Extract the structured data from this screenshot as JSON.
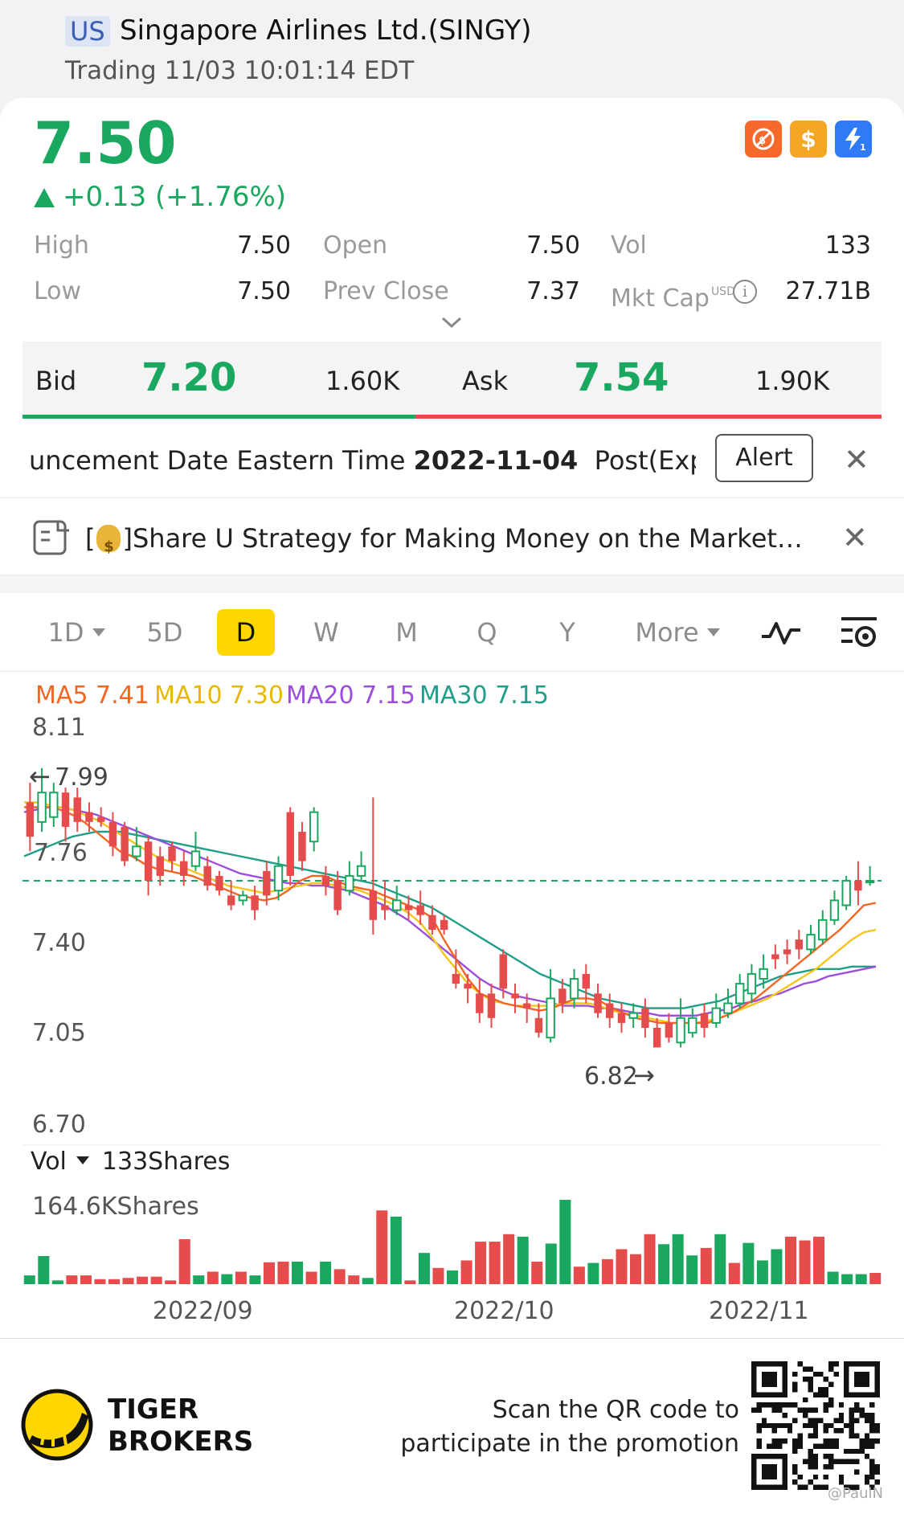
{
  "header": {
    "market": "US",
    "name": "Singapore Airlines Ltd.(SINGY)",
    "status": "Trading 11/03 10:01:14 EDT"
  },
  "quote": {
    "price": "7.50",
    "change": "+0.13 (+1.76%)",
    "badges": [
      {
        "icon": "no-shorting-icon",
        "color": "#f56a2b"
      },
      {
        "icon": "dollar-icon",
        "color": "#f5a623"
      },
      {
        "icon": "lightning-icon",
        "color": "#2f7bf5"
      }
    ]
  },
  "stats": {
    "high_label": "High",
    "high": "7.50",
    "low_label": "Low",
    "low": "7.50",
    "open_label": "Open",
    "open": "7.50",
    "prev_close_label": "Prev Close",
    "prev_close": "7.37",
    "vol_label": "Vol",
    "vol": "133",
    "mkt_cap_label": "Mkt Cap",
    "mkt_cap_currency": "USD",
    "mkt_cap": "27.71B"
  },
  "bidask": {
    "bid_label": "Bid",
    "bid": "7.20",
    "bid_size": "1.60K",
    "ask_label": "Ask",
    "ask": "7.54",
    "ask_size": "1.90K"
  },
  "announcement": {
    "text_pre": "uncement Date Eastern Time ",
    "date": "2022-11-04",
    "text_post": "  Post(Expe",
    "alert_label": "Alert"
  },
  "share": {
    "bracket_open": "[",
    "text": "]Share U Strategy for Making Money on the Market…"
  },
  "tabs": [
    {
      "label": "1D",
      "dropdown": true
    },
    {
      "label": "5D"
    },
    {
      "label": "D",
      "active": true
    },
    {
      "label": "W"
    },
    {
      "label": "M"
    },
    {
      "label": "Q"
    },
    {
      "label": "Y"
    },
    {
      "label": "More",
      "dropdown": true
    }
  ],
  "ma": {
    "ma5": "MA5 7.41",
    "ma10": "MA10 7.30",
    "ma20": "MA20 7.15",
    "ma30": "MA30 7.15",
    "colors": {
      "ma5": "#f26522",
      "ma10": "#f5c518",
      "ma20": "#9b4ddc",
      "ma30": "#1f9e8a"
    }
  },
  "chart_data": {
    "type": "candlestick",
    "y_ticks": [
      "8.11",
      "7.40",
      "7.05",
      "6.70"
    ],
    "ylim": [
      6.7,
      8.11
    ],
    "max_label": "7.99",
    "min_label": "6.82",
    "side_label": "7.76",
    "last_price_line": 7.5,
    "x_labels": [
      "2022/09",
      "2022/10",
      "2022/11"
    ],
    "candles": [
      [
        7.82,
        7.68,
        7.9,
        7.62
      ],
      [
        7.74,
        7.86,
        7.96,
        7.7
      ],
      [
        7.76,
        7.86,
        7.9,
        7.72
      ],
      [
        7.86,
        7.72,
        7.88,
        7.66
      ],
      [
        7.84,
        7.74,
        7.88,
        7.7
      ],
      [
        7.78,
        7.74,
        7.82,
        7.7
      ],
      [
        7.76,
        7.74,
        7.8,
        7.72
      ],
      [
        7.74,
        7.64,
        7.78,
        7.6
      ],
      [
        7.72,
        7.58,
        7.74,
        7.56
      ],
      [
        7.6,
        7.64,
        7.72,
        7.58
      ],
      [
        7.66,
        7.5,
        7.68,
        7.44
      ],
      [
        7.6,
        7.52,
        7.64,
        7.48
      ],
      [
        7.64,
        7.58,
        7.66,
        7.54
      ],
      [
        7.58,
        7.52,
        7.62,
        7.48
      ],
      [
        7.56,
        7.62,
        7.7,
        7.54
      ],
      [
        7.56,
        7.48,
        7.6,
        7.46
      ],
      [
        7.52,
        7.46,
        7.54,
        7.44
      ],
      [
        7.44,
        7.4,
        7.5,
        7.38
      ],
      [
        7.42,
        7.44,
        7.46,
        7.4
      ],
      [
        7.44,
        7.38,
        7.48,
        7.34
      ],
      [
        7.54,
        7.44,
        7.58,
        7.4
      ],
      [
        7.46,
        7.56,
        7.6,
        7.42
      ],
      [
        7.78,
        7.52,
        7.8,
        7.48
      ],
      [
        7.7,
        7.58,
        7.74,
        7.54
      ],
      [
        7.66,
        7.78,
        7.8,
        7.62
      ],
      [
        7.52,
        7.48,
        7.56,
        7.44
      ],
      [
        7.5,
        7.38,
        7.54,
        7.36
      ],
      [
        7.46,
        7.52,
        7.58,
        7.44
      ],
      [
        7.52,
        7.56,
        7.62,
        7.5
      ],
      [
        7.46,
        7.34,
        7.84,
        7.28
      ],
      [
        7.4,
        7.38,
        7.5,
        7.34
      ],
      [
        7.38,
        7.42,
        7.48,
        7.36
      ],
      [
        7.4,
        7.38,
        7.44,
        7.34
      ],
      [
        7.4,
        7.36,
        7.46,
        7.32
      ],
      [
        7.36,
        7.3,
        7.4,
        7.28
      ],
      [
        7.34,
        7.3,
        7.36,
        7.28
      ],
      [
        7.12,
        7.08,
        7.22,
        7.06
      ],
      [
        7.08,
        7.06,
        7.12,
        7.0
      ],
      [
        7.04,
        6.96,
        7.1,
        6.92
      ],
      [
        7.04,
        6.94,
        7.08,
        6.9
      ],
      [
        7.2,
        7.06,
        7.22,
        7.02
      ],
      [
        7.04,
        7.02,
        7.08,
        6.96
      ],
      [
        7.0,
        6.98,
        7.04,
        6.92
      ],
      [
        6.94,
        6.88,
        7.0,
        6.86
      ],
      [
        6.86,
        7.02,
        7.14,
        6.84
      ],
      [
        7.06,
        7.0,
        7.1,
        6.96
      ],
      [
        7.02,
        7.1,
        7.14,
        6.98
      ],
      [
        7.12,
        7.06,
        7.16,
        7.0
      ],
      [
        7.04,
        6.96,
        7.08,
        6.94
      ],
      [
        7.0,
        6.94,
        7.04,
        6.9
      ],
      [
        6.96,
        6.92,
        7.0,
        6.88
      ],
      [
        6.94,
        6.96,
        7.0,
        6.9
      ],
      [
        6.98,
        6.9,
        7.02,
        6.86
      ],
      [
        6.9,
        6.82,
        6.94,
        6.82
      ],
      [
        6.92,
        6.86,
        6.96,
        6.84
      ],
      [
        6.84,
        6.94,
        7.02,
        6.82
      ],
      [
        6.88,
        6.94,
        6.98,
        6.86
      ],
      [
        6.96,
        6.9,
        7.0,
        6.86
      ],
      [
        6.92,
        6.98,
        7.04,
        6.9
      ],
      [
        6.96,
        7.0,
        7.06,
        6.94
      ],
      [
        7.0,
        7.08,
        7.12,
        6.98
      ],
      [
        7.04,
        7.12,
        7.16,
        7.0
      ],
      [
        7.1,
        7.14,
        7.2,
        7.06
      ],
      [
        7.2,
        7.18,
        7.24,
        7.14
      ],
      [
        7.22,
        7.2,
        7.26,
        7.16
      ],
      [
        7.26,
        7.22,
        7.3,
        7.18
      ],
      [
        7.22,
        7.28,
        7.32,
        7.2
      ],
      [
        7.26,
        7.34,
        7.38,
        7.24
      ],
      [
        7.34,
        7.42,
        7.46,
        7.32
      ],
      [
        7.4,
        7.5,
        7.52,
        7.38
      ],
      [
        7.5,
        7.46,
        7.58,
        7.4
      ],
      [
        7.5,
        7.5,
        7.56,
        7.48
      ]
    ],
    "ma_series": {
      "ma5": [
        7.8,
        7.8,
        7.8,
        7.79,
        7.77,
        7.74,
        7.7,
        7.66,
        7.62,
        7.6,
        7.57,
        7.55,
        7.54,
        7.53,
        7.52,
        7.5,
        7.48,
        7.46,
        7.44,
        7.43,
        7.42,
        7.43,
        7.46,
        7.5,
        7.52,
        7.52,
        7.5,
        7.48,
        7.47,
        7.46,
        7.44,
        7.42,
        7.4,
        7.38,
        7.35,
        7.26,
        7.18,
        7.1,
        7.04,
        7.02,
        7.0,
        6.99,
        6.98,
        6.97,
        6.98,
        7.0,
        7.02,
        7.02,
        7.01,
        6.98,
        6.96,
        6.94,
        6.93,
        6.92,
        6.92,
        6.92,
        6.92,
        6.92,
        6.94,
        6.96,
        6.99,
        7.02,
        7.06,
        7.1,
        7.14,
        7.18,
        7.22,
        7.26,
        7.3,
        7.35,
        7.4,
        7.41
      ],
      "ma10": [
        7.82,
        7.82,
        7.81,
        7.8,
        7.79,
        7.77,
        7.75,
        7.72,
        7.69,
        7.66,
        7.63,
        7.6,
        7.58,
        7.56,
        7.54,
        7.52,
        7.5,
        7.48,
        7.47,
        7.46,
        7.45,
        7.46,
        7.47,
        7.48,
        7.49,
        7.49,
        7.48,
        7.47,
        7.46,
        7.44,
        7.42,
        7.4,
        7.37,
        7.33,
        7.27,
        7.2,
        7.14,
        7.08,
        7.04,
        7.01,
        7.0,
        6.99,
        6.99,
        6.99,
        6.99,
        7.0,
        7.0,
        7.0,
        6.99,
        6.97,
        6.96,
        6.95,
        6.94,
        6.93,
        6.92,
        6.92,
        6.92,
        6.93,
        6.94,
        6.96,
        6.98,
        7.0,
        7.02,
        7.05,
        7.08,
        7.11,
        7.14,
        7.18,
        7.22,
        7.26,
        7.29,
        7.3
      ],
      "ma20": [
        7.78,
        7.79,
        7.8,
        7.8,
        7.79,
        7.78,
        7.77,
        7.75,
        7.73,
        7.71,
        7.69,
        7.67,
        7.65,
        7.63,
        7.61,
        7.59,
        7.57,
        7.55,
        7.53,
        7.52,
        7.51,
        7.5,
        7.49,
        7.49,
        7.48,
        7.48,
        7.47,
        7.46,
        7.44,
        7.42,
        7.4,
        7.37,
        7.34,
        7.3,
        7.26,
        7.22,
        7.18,
        7.14,
        7.1,
        7.07,
        7.05,
        7.03,
        7.02,
        7.01,
        7.0,
        6.99,
        6.99,
        6.99,
        6.98,
        6.98,
        6.97,
        6.96,
        6.96,
        6.95,
        6.95,
        6.95,
        6.95,
        6.96,
        6.97,
        6.98,
        7.0,
        7.01,
        7.03,
        7.04,
        7.06,
        7.08,
        7.09,
        7.11,
        7.12,
        7.13,
        7.14,
        7.15
      ],
      "ma30": [
        7.6,
        7.62,
        7.64,
        7.66,
        7.68,
        7.69,
        7.7,
        7.7,
        7.7,
        7.69,
        7.68,
        7.67,
        7.66,
        7.65,
        7.64,
        7.63,
        7.62,
        7.61,
        7.6,
        7.59,
        7.58,
        7.57,
        7.56,
        7.55,
        7.54,
        7.53,
        7.52,
        7.51,
        7.5,
        7.49,
        7.47,
        7.45,
        7.43,
        7.41,
        7.39,
        7.36,
        7.33,
        7.3,
        7.27,
        7.24,
        7.21,
        7.18,
        7.15,
        7.12,
        7.1,
        7.08,
        7.06,
        7.04,
        7.02,
        7.01,
        7.0,
        6.99,
        6.98,
        6.98,
        6.98,
        6.98,
        6.99,
        7.0,
        7.01,
        7.03,
        7.05,
        7.07,
        7.09,
        7.11,
        7.12,
        7.13,
        7.14,
        7.14,
        7.14,
        7.15,
        7.15,
        7.15
      ]
    },
    "volume": {
      "label": "Vol",
      "current": "133Shares",
      "max_label": "164.6KShares",
      "max": 164600,
      "bars": [
        {
          "v": 14000,
          "up": true
        },
        {
          "v": 45000,
          "up": true
        },
        {
          "v": 6000,
          "up": true
        },
        {
          "v": 14000,
          "up": false
        },
        {
          "v": 14000,
          "up": false
        },
        {
          "v": 8000,
          "up": false
        },
        {
          "v": 8000,
          "up": false
        },
        {
          "v": 10000,
          "up": false
        },
        {
          "v": 12000,
          "up": false
        },
        {
          "v": 12000,
          "up": false
        },
        {
          "v": 6000,
          "up": false
        },
        {
          "v": 72000,
          "up": false
        },
        {
          "v": 14000,
          "up": true
        },
        {
          "v": 20000,
          "up": false
        },
        {
          "v": 16000,
          "up": true
        },
        {
          "v": 20000,
          "up": false
        },
        {
          "v": 14000,
          "up": true
        },
        {
          "v": 35000,
          "up": false
        },
        {
          "v": 36000,
          "up": false
        },
        {
          "v": 36000,
          "up": true
        },
        {
          "v": 20000,
          "up": false
        },
        {
          "v": 36000,
          "up": true
        },
        {
          "v": 24000,
          "up": false
        },
        {
          "v": 14000,
          "up": false
        },
        {
          "v": 10000,
          "up": true
        },
        {
          "v": 118000,
          "up": false
        },
        {
          "v": 108000,
          "up": true
        },
        {
          "v": 6000,
          "up": false
        },
        {
          "v": 50000,
          "up": true
        },
        {
          "v": 26000,
          "up": false
        },
        {
          "v": 22000,
          "up": true
        },
        {
          "v": 38000,
          "up": false
        },
        {
          "v": 68000,
          "up": false
        },
        {
          "v": 68000,
          "up": false
        },
        {
          "v": 80000,
          "up": false
        },
        {
          "v": 76000,
          "up": true
        },
        {
          "v": 36000,
          "up": false
        },
        {
          "v": 65000,
          "up": true
        },
        {
          "v": 135000,
          "up": true
        },
        {
          "v": 28000,
          "up": false
        },
        {
          "v": 34000,
          "up": true
        },
        {
          "v": 40000,
          "up": false
        },
        {
          "v": 56000,
          "up": false
        },
        {
          "v": 48000,
          "up": false
        },
        {
          "v": 80000,
          "up": false
        },
        {
          "v": 64000,
          "up": true
        },
        {
          "v": 80000,
          "up": true
        },
        {
          "v": 46000,
          "up": true
        },
        {
          "v": 58000,
          "up": false
        },
        {
          "v": 80000,
          "up": true
        },
        {
          "v": 34000,
          "up": false
        },
        {
          "v": 66000,
          "up": true
        },
        {
          "v": 38000,
          "up": true
        },
        {
          "v": 56000,
          "up": true
        },
        {
          "v": 76000,
          "up": false
        },
        {
          "v": 70000,
          "up": false
        },
        {
          "v": 76000,
          "up": false
        },
        {
          "v": 20000,
          "up": true
        },
        {
          "v": 16000,
          "up": true
        },
        {
          "v": 16000,
          "up": true
        },
        {
          "v": 18000,
          "up": false
        }
      ]
    }
  },
  "footer": {
    "brand_line1": "TIGER",
    "brand_line2": "BROKERS",
    "promo_line1": "Scan the QR code to",
    "promo_line2": "participate in the promotion",
    "watermark": "@PaulN"
  }
}
